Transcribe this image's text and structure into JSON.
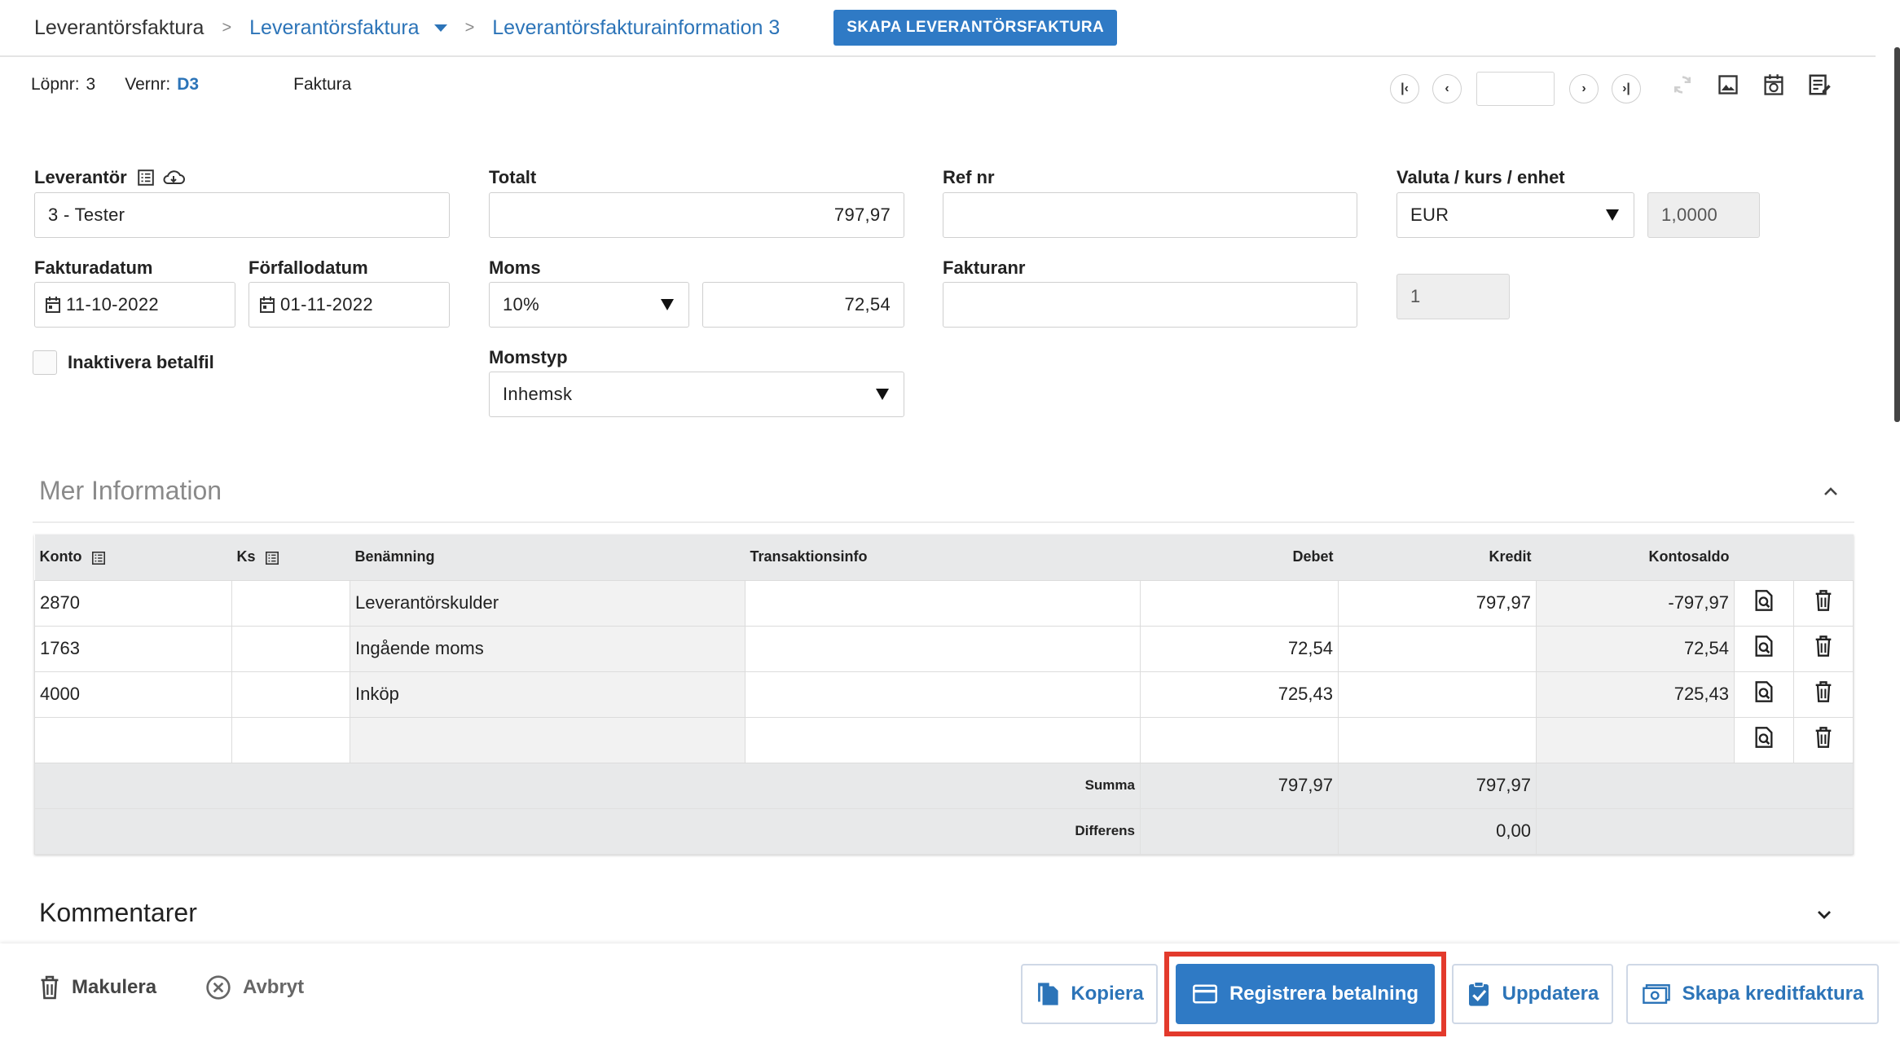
{
  "breadcrumb": {
    "items": [
      "Leverantörsfaktura",
      "Leverantörsfaktura",
      "Leverantörsfakturainformation 3"
    ],
    "separator": ">",
    "create_button": "SKAPA LEVERANTÖRSFAKTURA"
  },
  "info": {
    "lopnr_label": "Löpnr:",
    "lopnr_value": "3",
    "vernr_label": "Vernr:",
    "vernr_value": "D3",
    "type": "Faktura"
  },
  "form": {
    "leverantor_label": "Leverantör",
    "leverantor_value": "3 - Tester",
    "totalt_label": "Totalt",
    "totalt_value": "797,97",
    "refnr_label": "Ref nr",
    "refnr_value": "",
    "valuta_label": "Valuta / kurs / enhet",
    "valuta_value": "EUR",
    "kurs_value": "1,0000",
    "enhet_value": "1",
    "fakturadatum_label": "Fakturadatum",
    "fakturadatum_value": "11-10-2022",
    "forfallodatum_label": "Förfallodatum",
    "forfallodatum_value": "01-11-2022",
    "moms_label": "Moms",
    "moms_rate": "10%",
    "moms_amount": "72,54",
    "fakturanr_label": "Fakturanr",
    "fakturanr_value": "",
    "inaktivera_label": "Inaktivera betalfil",
    "momstyp_label": "Momstyp",
    "momstyp_value": "Inhemsk"
  },
  "sections": {
    "mer_information": "Mer Information",
    "kommentarer": "Kommentarer"
  },
  "ledger": {
    "headers": {
      "konto": "Konto",
      "ks": "Ks",
      "benamning": "Benämning",
      "transaktionsinfo": "Transaktionsinfo",
      "debet": "Debet",
      "kredit": "Kredit",
      "kontosaldo": "Kontosaldo"
    },
    "rows": [
      {
        "konto": "2870",
        "ks": "",
        "benamning": "Leverantörskulder",
        "info": "",
        "debet": "",
        "kredit": "797,97",
        "saldo": "-797,97"
      },
      {
        "konto": "1763",
        "ks": "",
        "benamning": "Ingående moms",
        "info": "",
        "debet": "72,54",
        "kredit": "",
        "saldo": "72,54"
      },
      {
        "konto": "4000",
        "ks": "",
        "benamning": "Inköp",
        "info": "",
        "debet": "725,43",
        "kredit": "",
        "saldo": "725,43"
      },
      {
        "konto": "",
        "ks": "",
        "benamning": "",
        "info": "",
        "debet": "",
        "kredit": "",
        "saldo": ""
      }
    ],
    "summa_label": "Summa",
    "summa_debet": "797,97",
    "summa_kredit": "797,97",
    "differens_label": "Differens",
    "differens_kredit": "0,00"
  },
  "footer": {
    "makulera": "Makulera",
    "avbryt": "Avbryt",
    "kopiera": "Kopiera",
    "registrera": "Registrera betalning",
    "uppdatera": "Uppdatera",
    "kreditfaktura": "Skapa kreditfaktura"
  },
  "colors": {
    "accent": "#2f7ac5",
    "link": "#2c74b8",
    "highlight": "#e33a2c"
  }
}
